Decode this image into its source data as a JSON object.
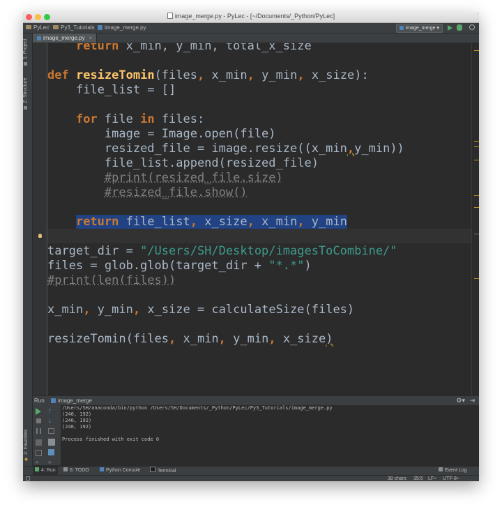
{
  "window": {
    "title": "image_merge.py - PyLec - [~/Documents/_Python/PyLec]"
  },
  "navbar": {
    "breadcrumbs": [
      "PyLec",
      "Py3_Tutorials",
      "image_merge.py"
    ],
    "run_config": "image_merge"
  },
  "left_tabs": {
    "project": "1: Project",
    "structure": "Z: Structure",
    "favorites": "2: Favorites"
  },
  "editor": {
    "tab": "image_merge.py",
    "lines": [
      {
        "indent": "    ",
        "tokens": [
          {
            "t": "return",
            "c": "kw"
          },
          {
            "t": " x_min, y_min, total_x_size",
            "c": ""
          }
        ]
      },
      {
        "indent": "",
        "tokens": []
      },
      {
        "indent": "",
        "tokens": [
          {
            "t": "def",
            "c": "kw"
          },
          {
            "t": " ",
            "c": ""
          },
          {
            "t": "resizeTomin",
            "c": "fn"
          },
          {
            "t": "(files",
            "c": ""
          },
          {
            "t": ",",
            "c": "kw"
          },
          {
            "t": " x_min",
            "c": ""
          },
          {
            "t": ",",
            "c": "kw"
          },
          {
            "t": " y_min",
            "c": ""
          },
          {
            "t": ",",
            "c": "kw"
          },
          {
            "t": " x_size):",
            "c": ""
          }
        ]
      },
      {
        "indent": "    ",
        "tokens": [
          {
            "t": "file_list = []",
            "c": ""
          }
        ]
      },
      {
        "indent": "",
        "tokens": []
      },
      {
        "indent": "    ",
        "tokens": [
          {
            "t": "for",
            "c": "kw"
          },
          {
            "t": " file ",
            "c": ""
          },
          {
            "t": "in",
            "c": "kw"
          },
          {
            "t": " files:",
            "c": ""
          }
        ]
      },
      {
        "indent": "        ",
        "tokens": [
          {
            "t": "image = Image.open(file)",
            "c": ""
          }
        ]
      },
      {
        "indent": "        ",
        "tokens": [
          {
            "t": "resized_file = image.resize((x_min",
            "c": ""
          },
          {
            "t": ",",
            "c": "kw wavy"
          },
          {
            "t": "y_min))",
            "c": ""
          }
        ]
      },
      {
        "indent": "        ",
        "tokens": [
          {
            "t": "file_list.append(resized_file)",
            "c": ""
          }
        ]
      },
      {
        "indent": "        ",
        "tokens": [
          {
            "t": "#print(resized_file.size)",
            "c": "cm"
          }
        ]
      },
      {
        "indent": "        ",
        "tokens": [
          {
            "t": "#resized_file.show()",
            "c": "cm"
          }
        ]
      },
      {
        "indent": "",
        "tokens": []
      },
      {
        "indent": "    ",
        "tokens": [
          {
            "t": "return",
            "c": "kw sel"
          },
          {
            "t": " file_list",
            "c": "sel"
          },
          {
            "t": ",",
            "c": "kw sel"
          },
          {
            "t": " x_size",
            "c": "sel"
          },
          {
            "t": ",",
            "c": "kw sel"
          },
          {
            "t": " x_min",
            "c": "sel"
          },
          {
            "t": ",",
            "c": "kw sel"
          },
          {
            "t": " y_min",
            "c": "sel"
          }
        ]
      },
      {
        "indent": "",
        "tokens": []
      },
      {
        "indent": "",
        "tokens": [
          {
            "t": "target_dir = ",
            "c": ""
          },
          {
            "t": "\"/Users/SH/Desktop/imagesToCombine/\"",
            "c": "st"
          }
        ]
      },
      {
        "indent": "",
        "tokens": [
          {
            "t": "files = glob.glob(target_dir + ",
            "c": ""
          },
          {
            "t": "\"*.*\"",
            "c": "st"
          },
          {
            "t": ")",
            "c": ""
          }
        ]
      },
      {
        "indent": "",
        "tokens": [
          {
            "t": "#print(len(files))",
            "c": "cm"
          }
        ]
      },
      {
        "indent": "",
        "tokens": []
      },
      {
        "indent": "",
        "tokens": [
          {
            "t": "x_min",
            "c": ""
          },
          {
            "t": ",",
            "c": "kw"
          },
          {
            "t": " y_min",
            "c": ""
          },
          {
            "t": ",",
            "c": "kw"
          },
          {
            "t": " x_size = calculateSize(files)",
            "c": ""
          }
        ]
      },
      {
        "indent": "",
        "tokens": []
      },
      {
        "indent": "",
        "tokens": [
          {
            "t": "resizeTomin(files",
            "c": ""
          },
          {
            "t": ",",
            "c": "kw"
          },
          {
            "t": " x_min",
            "c": ""
          },
          {
            "t": ",",
            "c": "kw"
          },
          {
            "t": " y_min",
            "c": ""
          },
          {
            "t": ",",
            "c": "kw"
          },
          {
            "t": " x_size",
            "c": ""
          },
          {
            "t": ")",
            "c": "wavy"
          }
        ]
      }
    ]
  },
  "run_panel": {
    "label": "Run",
    "config": "image_merge",
    "output": [
      "/Users/SH/anaconda/bin/python /Users/SH/Documents/_Python/PyLec/Py3_Tutorials/image_merge.py",
      "(240, 192)",
      "(240, 192)",
      "(240, 192)",
      "",
      "Process finished with exit code 0"
    ]
  },
  "bottom_tabs": {
    "run": "4: Run",
    "todo": "6: TODO",
    "python_console": "Python Console",
    "terminal": "Terminal",
    "event_log": "Event Log"
  },
  "status": {
    "chars": "38 chars",
    "position": "35:5",
    "line_sep": "LF÷",
    "encoding": "UTF-8÷"
  },
  "colors": {
    "keyword": "#cc7832",
    "function": "#ffc66d",
    "string": "#3e9a8c",
    "comment": "#808080",
    "selection": "#214283",
    "editor_bg": "#2b2b2b"
  }
}
